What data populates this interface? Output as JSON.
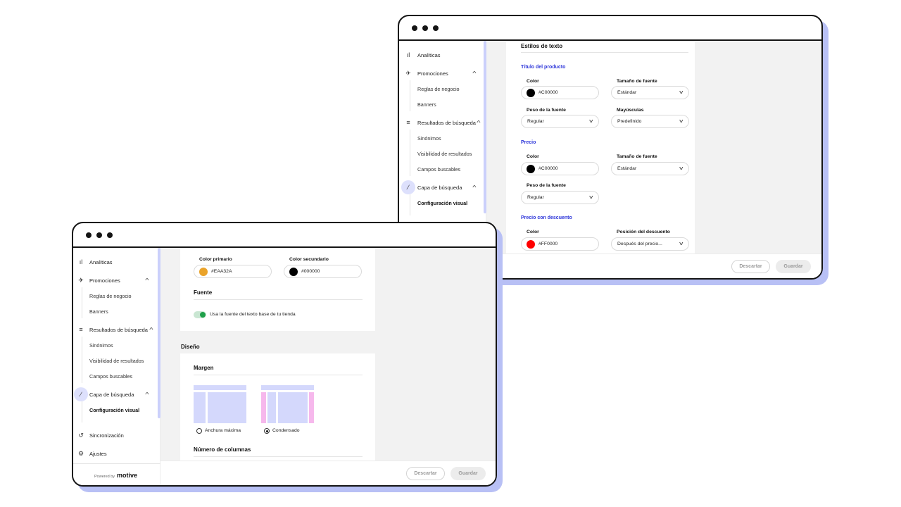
{
  "sidebar": {
    "analytics": "Analíticas",
    "promotions": "Promociones",
    "business_rules": "Reglas de negocio",
    "banners": "Banners",
    "search_results": "Resultados de búsqueda",
    "synonyms": "Sinónimos",
    "results_visibility": "Visibilidad de resultados",
    "searchable_fields": "Campos buscables",
    "search_layer": "Capa de búsqueda",
    "visual_config": "Configuración visual",
    "sync": "Sincronización",
    "settings": "Ajustes",
    "powered_by": "Powered by",
    "brand": "motive"
  },
  "back_window": {
    "text_styles_title": "Estilos de texto",
    "product_title": {
      "heading": "Título del producto",
      "color_label": "Color",
      "color_value": "#C00000",
      "color_swatch": "#000000",
      "font_size_label": "Tamaño de fuente",
      "font_size_value": "Estándar",
      "font_weight_label": "Peso de la fuente",
      "font_weight_value": "Regular",
      "uppercase_label": "Mayúsculas",
      "uppercase_value": "Predefinido"
    },
    "price": {
      "heading": "Precio",
      "color_label": "Color",
      "color_value": "#C00000",
      "color_swatch": "#000000",
      "font_size_label": "Tamaño de fuente",
      "font_size_value": "Estándar",
      "font_weight_label": "Peso de la fuente",
      "font_weight_value": "Regular"
    },
    "discount_price": {
      "heading": "Precio con descuento",
      "color_label": "Color",
      "color_value": "#FF0000",
      "color_swatch": "#FF0000",
      "position_label": "Posición del descuento",
      "position_value": "Después del precio..."
    },
    "discard": "Descartar",
    "save": "Guardar"
  },
  "front_window": {
    "primary_color_label": "Color primario",
    "primary_color_value": "#EAA32A",
    "primary_swatch": "#EAA32A",
    "secondary_color_label": "Color secundario",
    "secondary_color_value": "#000000",
    "secondary_swatch": "#000000",
    "font_title": "Fuente",
    "font_toggle_label": "Usa la fuente del texto base de tu tienda",
    "font_toggle_on": true,
    "design_title": "Diseño",
    "margin_title": "Margen",
    "margin_option_max": "Anchura máxima",
    "margin_option_condensed": "Condensado",
    "margin_selected": "Condensado",
    "columns_title": "Número de columnas",
    "discard": "Descartar",
    "save": "Guardar"
  },
  "colors": {
    "accent_blue": "#2C35D9",
    "frame_shadow": "#B8C0F5",
    "layout_blue": "#D4D8FC",
    "layout_pink": "#F6B8EC",
    "toggle_green": "#1FA04A"
  }
}
